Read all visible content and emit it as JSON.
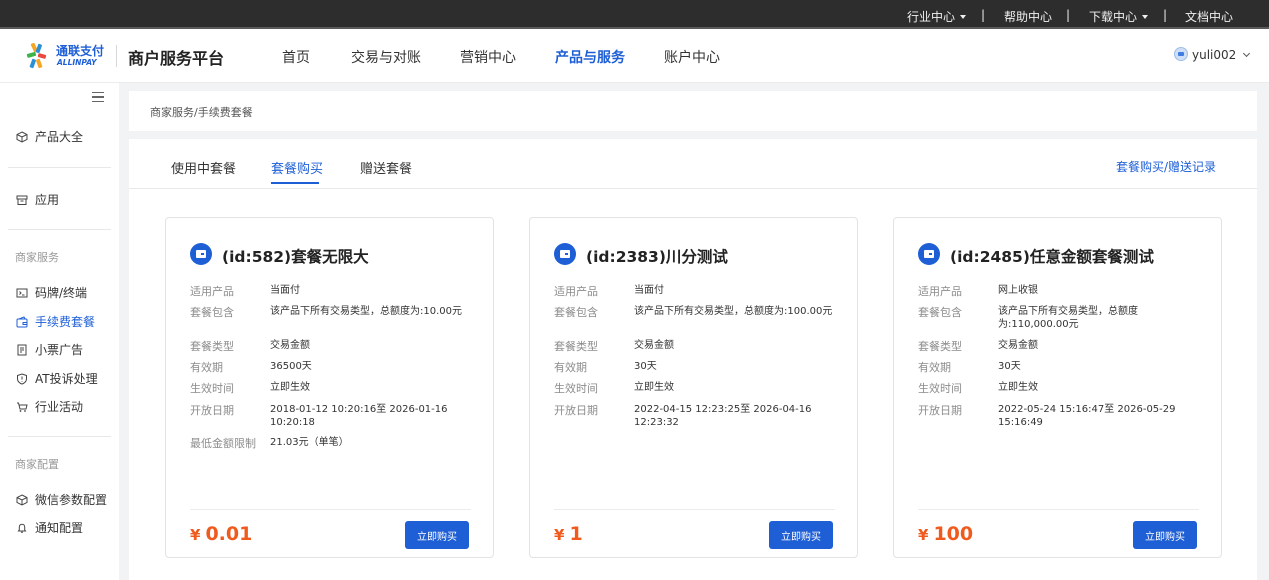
{
  "topbar": {
    "industry_center": "行业中心",
    "help_center": "帮助中心",
    "download_center": "下载中心",
    "doc_center": "文档中心",
    "separator": "|"
  },
  "header": {
    "logo_cn": "通联支付",
    "logo_en": "ALLINPAY",
    "platform_title": "商户服务平台",
    "nav": [
      "首页",
      "交易与对账",
      "营销中心",
      "产品与服务",
      "账户中心"
    ],
    "active_nav": "产品与服务",
    "username": "yuli002"
  },
  "sidebar": {
    "product_catalog": "产品大全",
    "apps": "应用",
    "merchant_services_heading": "商家服务",
    "merchant_services": [
      {
        "label": "码牌/终端",
        "icon": "qr-terminal-icon"
      },
      {
        "label": "手续费套餐",
        "icon": "wallet-icon"
      },
      {
        "label": "小票广告",
        "icon": "receipt-icon"
      },
      {
        "label": "AT投诉处理",
        "icon": "shield-icon"
      },
      {
        "label": "行业活动",
        "icon": "cart-icon"
      }
    ],
    "active_item": "手续费套餐",
    "merchant_config_heading": "商家配置",
    "merchant_config": [
      {
        "label": "微信参数配置",
        "icon": "cube-icon"
      },
      {
        "label": "通知配置",
        "icon": "bell-icon"
      }
    ]
  },
  "breadcrumb": "商家服务/手续费套餐",
  "tabs": [
    "使用中套餐",
    "套餐购买",
    "赠送套餐"
  ],
  "active_tab": "套餐购买",
  "records_link": "套餐购买/赠送记录",
  "labels": {
    "product": "适用产品",
    "contains": "套餐包含",
    "type": "套餐类型",
    "validity": "有效期",
    "effective": "生效时间",
    "open_date": "开放日期",
    "min_amount": "最低金额限制"
  },
  "cards": [
    {
      "title": "(id:582)套餐无限大",
      "product": "当面付",
      "contains": "该产品下所有交易类型，总额度为:10.00元",
      "type": "交易金额",
      "validity": "36500天",
      "effective": "立即生效",
      "open_date": "2018-01-12 10:20:16至 2026-01-16 10:20:18",
      "min_amount": "21.03元（单笔）",
      "currency": "¥",
      "price": "0.01",
      "buy_label": "立即购买"
    },
    {
      "title": "(id:2383)川分测试",
      "product": "当面付",
      "contains": "该产品下所有交易类型，总额度为:100.00元",
      "type": "交易金额",
      "validity": "30天",
      "effective": "立即生效",
      "open_date": "2022-04-15 12:23:25至 2026-04-16 12:23:32",
      "currency": "¥",
      "price": "1",
      "buy_label": "立即购买"
    },
    {
      "title": "(id:2485)任意金额套餐测试",
      "product": "网上收银",
      "contains": "该产品下所有交易类型，总额度为:110,000.00元",
      "type": "交易金额",
      "validity": "30天",
      "effective": "立即生效",
      "open_date": "2022-05-24 15:16:47至 2026-05-29 15:16:49",
      "currency": "¥",
      "price": "100",
      "buy_label": "立即购买"
    }
  ],
  "colors": {
    "accent": "#1e5fd6",
    "price": "#f05a1c",
    "topbar_bg": "#2d2d2d"
  }
}
